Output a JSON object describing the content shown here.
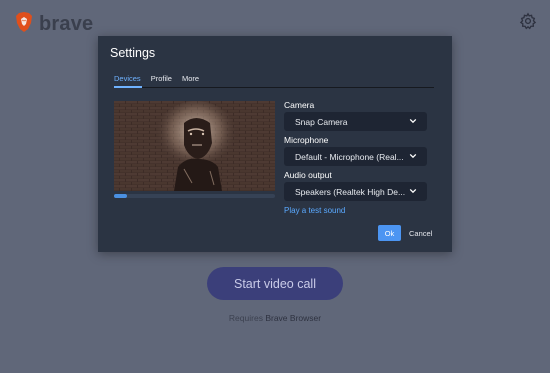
{
  "brand": {
    "name": "brave",
    "logo_icon": "brave-lion-icon",
    "logo_color": "#e04f1b"
  },
  "header": {
    "settings_icon": "gear-icon"
  },
  "main": {
    "cta_label": "Start video call",
    "requires_text": "Requires",
    "requires_product": "Brave Browser"
  },
  "settings": {
    "title": "Settings",
    "tabs": [
      {
        "label": "Devices",
        "active": true
      },
      {
        "label": "Profile",
        "active": false
      },
      {
        "label": "More",
        "active": false
      }
    ],
    "preview": {
      "audio_level": 0.08
    },
    "camera": {
      "label": "Camera",
      "value": "Snap Camera"
    },
    "microphone": {
      "label": "Microphone",
      "value": "Default - Microphone (Real..."
    },
    "audio_output": {
      "label": "Audio output",
      "value": "Speakers (Realtek High De..."
    },
    "test_sound_label": "Play a test sound",
    "ok_label": "Ok",
    "cancel_label": "Cancel"
  },
  "colors": {
    "accent": "#4c95f2",
    "link": "#5aa9ff",
    "dialog_bg": "#2b3443",
    "page_bg": "#606779"
  }
}
